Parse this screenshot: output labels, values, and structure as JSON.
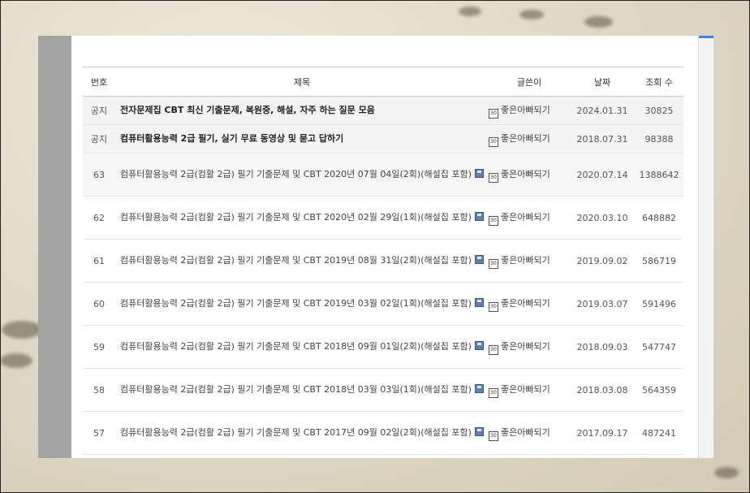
{
  "columns": {
    "num": "번호",
    "title": "제목",
    "writer": "글쓴이",
    "date": "날짜",
    "views": "조회 수"
  },
  "notices": [
    {
      "num": "공지",
      "title": "전자문제집 CBT 최신 기출문제, 복원중, 해설, 자주 하는 질문 모음",
      "writer": "좋은아빠되기",
      "date": "2024.01.31",
      "views": "30825"
    },
    {
      "num": "공지",
      "title": "컴퓨터활용능력 2급 필기, 실기 무료 동영상 및 묻고 답하기",
      "writer": "좋은아빠되기",
      "date": "2018.07.31",
      "views": "98388"
    }
  ],
  "posts": [
    {
      "num": "63",
      "title": "컴퓨터활용능력 2급(컴활 2급) 필기 기출문제 및 CBT 2020년 07월 04일(2회)(해설집 포함)",
      "writer": "좋은아빠되기",
      "date": "2020.07.14",
      "views": "1388642"
    },
    {
      "num": "62",
      "title": "컴퓨터활용능력 2급(컴활 2급) 필기 기출문제 및 CBT 2020년 02월 29일(1회)(해설집 포함)",
      "writer": "좋은아빠되기",
      "date": "2020.03.10",
      "views": "648882"
    },
    {
      "num": "61",
      "title": "컴퓨터활용능력 2급(컴활 2급) 필기 기출문제 및 CBT 2019년 08월 31일(2회)(해설집 포함)",
      "writer": "좋은아빠되기",
      "date": "2019.09.02",
      "views": "586719"
    },
    {
      "num": "60",
      "title": "컴퓨터활용능력 2급(컴활 2급) 필기 기출문제 및 CBT 2019년 03월 02일(1회)(해설집 포함)",
      "writer": "좋은아빠되기",
      "date": "2019.03.07",
      "views": "591496"
    },
    {
      "num": "59",
      "title": "컴퓨터활용능력 2급(컴활 2급) 필기 기출문제 및 CBT 2018년 09월 01일(2회)(해설집 포함)",
      "writer": "좋은아빠되기",
      "date": "2018.09.03",
      "views": "547747"
    },
    {
      "num": "58",
      "title": "컴퓨터활용능력 2급(컴활 2급) 필기 기출문제 및 CBT 2018년 03월 03일(1회)(해설집 포함)",
      "writer": "좋은아빠되기",
      "date": "2018.03.08",
      "views": "564359"
    },
    {
      "num": "57",
      "title": "컴퓨터활용능력 2급(컴활 2급) 필기 기출문제 및 CBT 2017년 09월 02일(2회)(해설집 포함)",
      "writer": "좋은아빠되기",
      "date": "2017.09.17",
      "views": "487241"
    }
  ],
  "writer_icon_text": "30",
  "icons": {
    "writer": "member-badge-icon",
    "attachment": "floppy-disk-icon"
  },
  "colors": {
    "accent": "#3a8ad6",
    "notice_bg": "#f4f4f4",
    "sidebar": "#a3a3a3"
  }
}
